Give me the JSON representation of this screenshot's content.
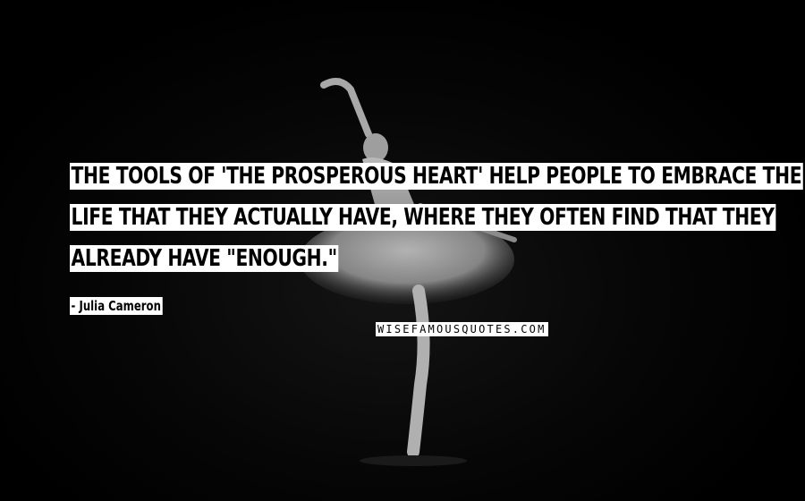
{
  "quote": {
    "line1": "The tools of 'The Prosperous Heart' help people to embrace the",
    "line2": "life that they actually have, where they often find that they",
    "line3": "already have \"enough.\""
  },
  "author": "- Julia Cameron",
  "watermark": "WISEFAMOUSQUOTES.COM",
  "colors": {
    "background": "#000000",
    "text_highlight": "#ffffff",
    "text": "#000000"
  }
}
